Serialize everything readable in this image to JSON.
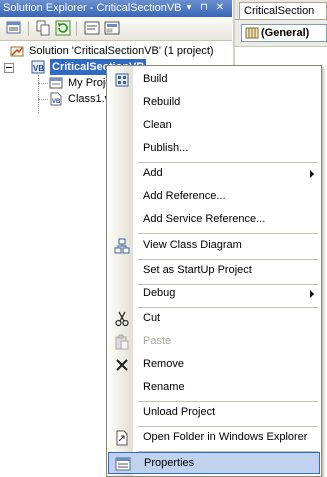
{
  "solution_explorer": {
    "title": "Solution Explorer - CriticalSectionVB",
    "title_buttons": [
      "▾",
      "⊓",
      "✕"
    ],
    "toolbar_icons": [
      "properties-icon",
      "show-all-files-icon",
      "refresh-icon",
      "view-code-icon",
      "view-designer-icon"
    ],
    "tree": {
      "solution": "Solution 'CriticalSectionVB' (1 project)",
      "project": "CriticalSectionVB",
      "children": [
        "My Project",
        "Class1.vb"
      ]
    }
  },
  "editor": {
    "tab": "CriticalSection",
    "combo_value": "(General)"
  },
  "context_menu": {
    "items": [
      {
        "label": "Build",
        "icon": "build-icon"
      },
      {
        "label": "Rebuild"
      },
      {
        "label": "Clean"
      },
      {
        "label": "Publish..."
      },
      {
        "separator": true
      },
      {
        "label": "Add",
        "submenu": true
      },
      {
        "label": "Add Reference..."
      },
      {
        "label": "Add Service Reference..."
      },
      {
        "separator": true
      },
      {
        "label": "View Class Diagram",
        "icon": "class-diagram-icon"
      },
      {
        "separator": true
      },
      {
        "label": "Set as StartUp Project"
      },
      {
        "separator": true
      },
      {
        "label": "Debug",
        "submenu": true
      },
      {
        "separator": true
      },
      {
        "label": "Cut",
        "icon": "scissors-icon"
      },
      {
        "label": "Paste",
        "icon": "paste-icon",
        "disabled": true
      },
      {
        "label": "Remove",
        "icon": "remove-x-icon"
      },
      {
        "label": "Rename"
      },
      {
        "separator": true
      },
      {
        "label": "Unload Project"
      },
      {
        "separator": true
      },
      {
        "label": "Open Folder in Windows Explorer",
        "icon": "open-folder-icon"
      },
      {
        "separator": true
      },
      {
        "label": "Properties",
        "icon": "properties-icon",
        "highlighted": true
      }
    ]
  },
  "colors": {
    "selection": "#316ac5",
    "menu_highlight": "#c1d2ee",
    "title_bar": "#3a66b8"
  }
}
